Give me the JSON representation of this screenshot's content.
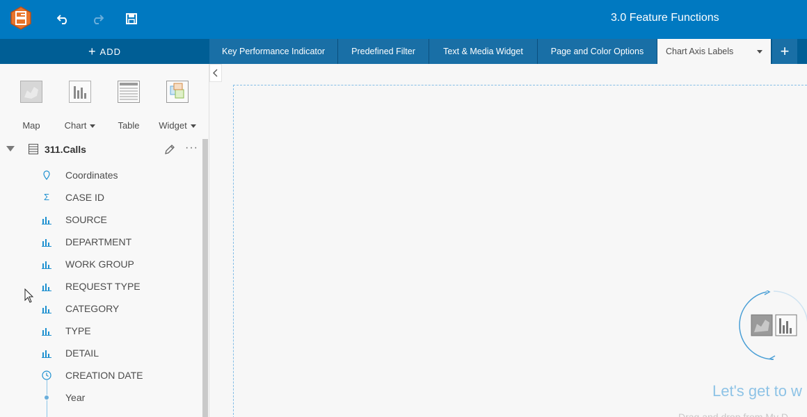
{
  "app": {
    "title": "3.0 Feature Functions"
  },
  "toolbar": {
    "undo_icon": "undo-icon",
    "redo_icon": "redo-icon",
    "save_icon": "save-icon"
  },
  "tabbar": {
    "add_label": "ADD",
    "tabs": [
      {
        "label": "Key Performance Indicator",
        "active": false
      },
      {
        "label": "Predefined Filter",
        "active": false
      },
      {
        "label": "Text & Media Widget",
        "active": false
      },
      {
        "label": "Page and Color Options",
        "active": false
      },
      {
        "label": "Chart Axis Labels",
        "active": true
      }
    ],
    "add_tab_label": "+"
  },
  "viz_types": [
    {
      "label": "Map",
      "has_dropdown": false
    },
    {
      "label": "Chart",
      "has_dropdown": true
    },
    {
      "label": "Table",
      "has_dropdown": false
    },
    {
      "label": "Widget",
      "has_dropdown": true
    }
  ],
  "dataset": {
    "name": "311.Calls",
    "more_label": "···",
    "fields": [
      {
        "name": "Coordinates",
        "icon": "location-icon"
      },
      {
        "name": "CASE ID",
        "icon": "sigma-icon"
      },
      {
        "name": "SOURCE",
        "icon": "string-icon"
      },
      {
        "name": "DEPARTMENT",
        "icon": "string-icon"
      },
      {
        "name": "WORK GROUP",
        "icon": "string-icon"
      },
      {
        "name": "REQUEST TYPE",
        "icon": "string-icon"
      },
      {
        "name": "CATEGORY",
        "icon": "string-icon"
      },
      {
        "name": "TYPE",
        "icon": "string-icon"
      },
      {
        "name": "DETAIL",
        "icon": "string-icon"
      },
      {
        "name": "CREATION DATE",
        "icon": "clock-icon"
      },
      {
        "name": "Year",
        "icon": "dot-icon"
      }
    ]
  },
  "canvas": {
    "welcome": "Let's get to w",
    "subtitle": "Drag and drop from My D"
  },
  "colors": {
    "topbar": "#0079c1",
    "tabbar": "#005e95",
    "accent": "#1e90d0"
  }
}
